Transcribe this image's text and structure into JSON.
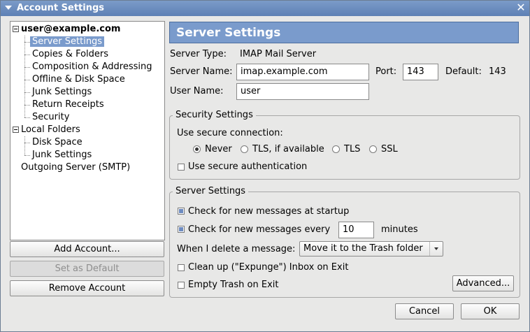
{
  "window": {
    "title": "Account Settings"
  },
  "tree": {
    "account": "user@example.com",
    "account_items": [
      "Server Settings",
      "Copies & Folders",
      "Composition & Addressing",
      "Offline & Disk Space",
      "Junk Settings",
      "Return Receipts",
      "Security"
    ],
    "local_folders": "Local Folders",
    "local_items": [
      "Disk Space",
      "Junk Settings"
    ],
    "outgoing": "Outgoing Server (SMTP)"
  },
  "left_buttons": {
    "add": "Add Account...",
    "default": "Set as Default",
    "remove": "Remove Account"
  },
  "panel": {
    "title": "Server Settings",
    "server_type_label": "Server Type:",
    "server_type_value": "IMAP Mail Server",
    "server_name_label": "Server Name:",
    "server_name_value": "imap.example.com",
    "port_label": "Port:",
    "port_value": "143",
    "default_label": "Default:",
    "default_value": "143",
    "user_name_label": "User Name:",
    "user_name_value": "user"
  },
  "security": {
    "legend": "Security Settings",
    "use_secure_label": "Use secure connection:",
    "options": [
      "Never",
      "TLS, if available",
      "TLS",
      "SSL"
    ],
    "selected": "Never",
    "secure_auth": "Use secure authentication",
    "secure_auth_checked": false
  },
  "server": {
    "legend": "Server Settings",
    "check_startup": "Check for new messages at startup",
    "check_startup_checked": true,
    "check_every_prefix": "Check for new messages every",
    "check_every_checked": true,
    "check_every_value": "10",
    "check_every_suffix": "minutes",
    "delete_label": "When I delete a message:",
    "delete_value": "Move it to the Trash folder",
    "cleanup": "Clean up (\"Expunge\") Inbox on Exit",
    "cleanup_checked": false,
    "empty_trash": "Empty Trash on Exit",
    "empty_trash_checked": false,
    "advanced": "Advanced..."
  },
  "dialog_buttons": {
    "cancel": "Cancel",
    "ok": "OK"
  }
}
